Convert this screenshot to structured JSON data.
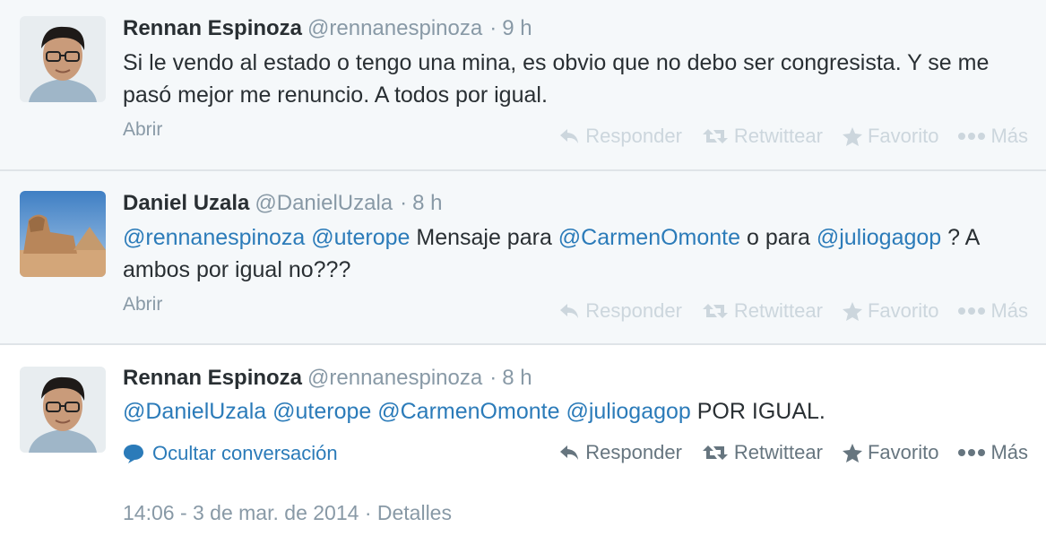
{
  "tweets": [
    {
      "fullname": "Rennan Espinoza",
      "username": "@rennanespinoza",
      "time": "9 h",
      "text": "Si le vendo al estado o tengo una mina, es obvio que no debo ser congresista. Y se me pasó mejor me renuncio. A todos por igual.",
      "open_label": "Abrir"
    },
    {
      "fullname": "Daniel Uzala",
      "username": "@DanielUzala",
      "time": "8 h",
      "mention1": "@rennanespinoza",
      "mention2": "@uterope",
      "text_a": " Mensaje para ",
      "mention3": "@CarmenOmonte",
      "text_b": " o para ",
      "mention4": "@juliogagop",
      "text_c": " ? A ambos por igual no???",
      "open_label": "Abrir"
    },
    {
      "fullname": "Rennan Espinoza",
      "username": "@rennanespinoza",
      "time": "8 h",
      "mention1": "@DanielUzala",
      "mention2": "@uterope",
      "mention3": "@CarmenOmonte",
      "mention4": "@juliogagop",
      "text_tail": " POR IGUAL.",
      "conversation_label": "Ocultar conversación",
      "timestamp": "14:06 - 3 de mar. de 2014",
      "details_label": "Detalles"
    }
  ],
  "actions": {
    "reply": "Responder",
    "retweet": "Retwittear",
    "favorite": "Favorito",
    "more": "Más"
  },
  "separator": "·",
  "colors": {
    "link": "#2b7bb9",
    "muted": "#8899a6",
    "faded_action": "#ccd6dd",
    "action": "#66757f",
    "context_bg": "#f5f8fa"
  }
}
